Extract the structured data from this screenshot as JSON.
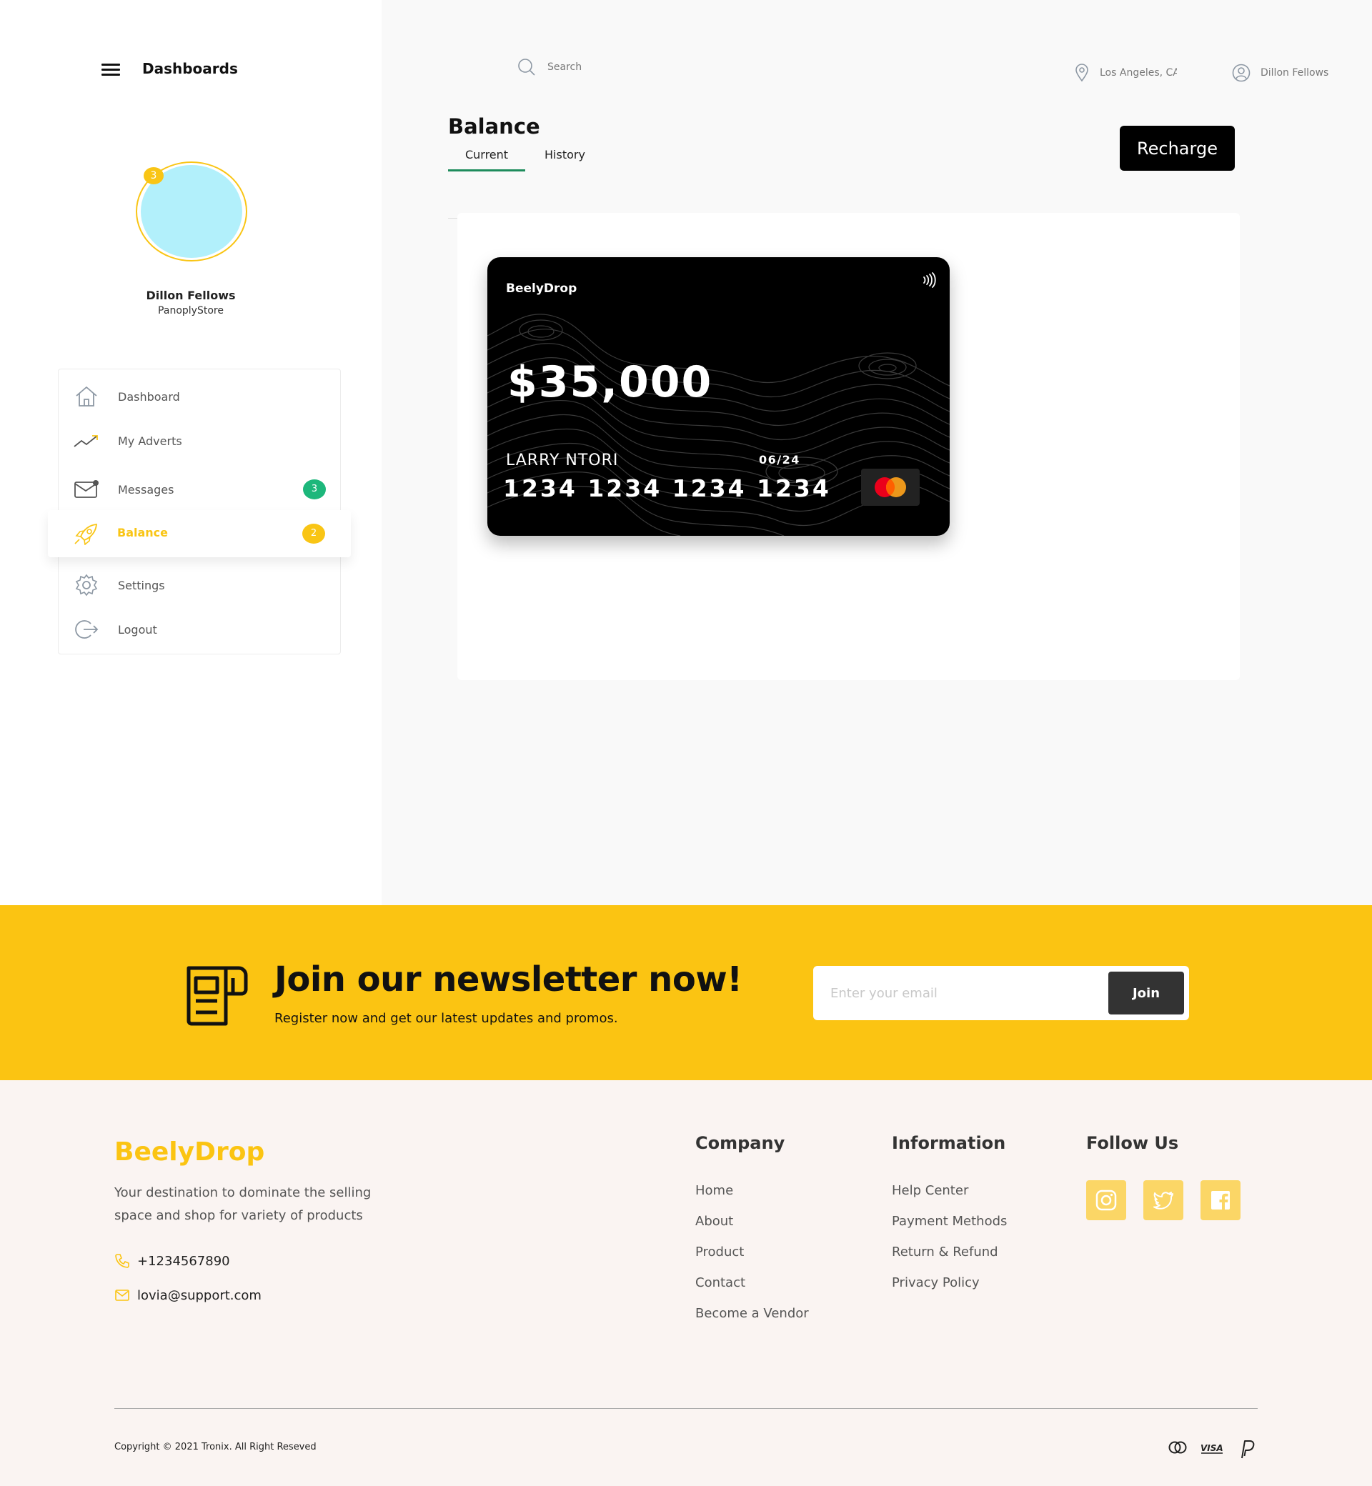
{
  "sidebar": {
    "title": "Dashboards",
    "avatar_badge": "3",
    "profile_name": "Dillon Fellows",
    "profile_store": "PanoplyStore",
    "items": [
      {
        "label": "Dashboard",
        "icon": "home-icon"
      },
      {
        "label": "My Adverts",
        "icon": "trend-up-icon"
      },
      {
        "label": "Messages",
        "icon": "mail-icon",
        "badge": "3"
      },
      {
        "label": "Balance",
        "icon": "rocket-icon",
        "badge": "2",
        "active": true
      },
      {
        "label": "Settings",
        "icon": "gear-icon"
      },
      {
        "label": "Logout",
        "icon": "logout-icon"
      }
    ]
  },
  "topbar": {
    "search_label": "Search",
    "location": "Los Angeles, CA",
    "user": "Dillon Fellows"
  },
  "balance": {
    "title": "Balance",
    "tabs": [
      "Current",
      "History"
    ],
    "recharge_label": "Recharge",
    "card": {
      "brand": "BeelyDrop",
      "amount": "$35,000",
      "holder": "LARRY NTORI",
      "expiry": "06/24",
      "number": "1234 1234 1234 1234"
    }
  },
  "newsletter": {
    "title": "Join our newsletter now!",
    "subtitle": "Register now and get our latest updates and promos.",
    "placeholder": "Enter your email",
    "join_label": "Join"
  },
  "footer": {
    "brand": "BeelyDrop",
    "description": "Your destination to dominate the selling space and shop for variety of products",
    "phone": "+1234567890",
    "email": "lovia@support.com",
    "company_title": "Company",
    "company_links": [
      "Home",
      "About",
      "Product",
      "Contact",
      "Become a Vendor"
    ],
    "info_title": "Information",
    "info_links": [
      "Help Center",
      "Payment Methods",
      "Return & Refund",
      "Privacy Policy"
    ],
    "follow_title": "Follow Us",
    "social": [
      "instagram-icon",
      "twitter-icon",
      "facebook-icon"
    ],
    "copyright": "Copyright © 2021 Tronix. All Right Reseved",
    "payments": [
      "mastercard-icon",
      "visa-icon",
      "paypal-icon"
    ]
  },
  "colors": {
    "accent": "#fbc412",
    "active_tab": "#1e8c5c",
    "messages_badge": "#1db77b",
    "avatar_fill": "#b2f0fb"
  }
}
